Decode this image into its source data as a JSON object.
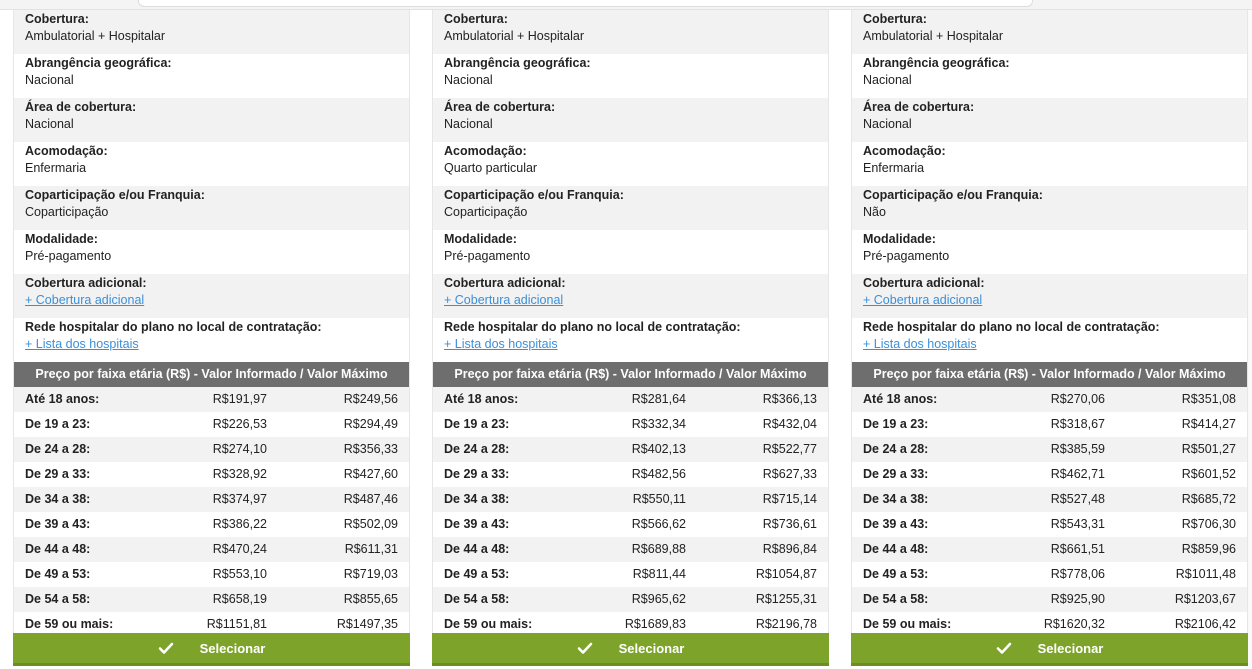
{
  "labels": {
    "cobertura": "Cobertura:",
    "abrangencia": "Abrangência geográfica:",
    "area": "Área de cobertura:",
    "acomodacao": "Acomodação:",
    "coparticipacao": "Coparticipação e/ou Franquia:",
    "modalidade": "Modalidade:",
    "cobertura_adicional": "Cobertura adicional:",
    "rede": "Rede hospitalar do plano no local de contratação:",
    "price_header": "Preço por faixa etária (R$) - Valor Informado / Valor Máximo",
    "select_button": "Selecionar"
  },
  "colors": {
    "accent_green": "#7ea32a",
    "header_gray": "#6e6e6e",
    "link_blue": "#3b8fd9"
  },
  "cards": [
    {
      "cobertura": "Ambulatorial + Hospitalar",
      "abrangencia": "Nacional",
      "area": "Nacional",
      "acomodacao": "Enfermaria",
      "coparticipacao": "Coparticipação",
      "modalidade": "Pré-pagamento",
      "cobertura_adicional_link": "+ Cobertura adicional",
      "rede_link": "+ Lista dos hospitais",
      "prices": [
        {
          "range": "Até 18 anos:",
          "informado": "R$191,97",
          "maximo": "R$249,56"
        },
        {
          "range": "De 19 a 23:",
          "informado": "R$226,53",
          "maximo": "R$294,49"
        },
        {
          "range": "De 24 a 28:",
          "informado": "R$274,10",
          "maximo": "R$356,33"
        },
        {
          "range": "De 29 a 33:",
          "informado": "R$328,92",
          "maximo": "R$427,60"
        },
        {
          "range": "De 34 a 38:",
          "informado": "R$374,97",
          "maximo": "R$487,46"
        },
        {
          "range": "De 39 a 43:",
          "informado": "R$386,22",
          "maximo": "R$502,09"
        },
        {
          "range": "De 44 a 48:",
          "informado": "R$470,24",
          "maximo": "R$611,31"
        },
        {
          "range": "De 49 a 53:",
          "informado": "R$553,10",
          "maximo": "R$719,03"
        },
        {
          "range": "De 54 a 58:",
          "informado": "R$658,19",
          "maximo": "R$855,65"
        },
        {
          "range": "De 59 ou mais:",
          "informado": "R$1151,81",
          "maximo": "R$1497,35"
        }
      ]
    },
    {
      "cobertura": "Ambulatorial + Hospitalar",
      "abrangencia": "Nacional",
      "area": "Nacional",
      "acomodacao": "Quarto particular",
      "coparticipacao": "Coparticipação",
      "modalidade": "Pré-pagamento",
      "cobertura_adicional_link": "+ Cobertura adicional",
      "rede_link": "+ Lista dos hospitais",
      "prices": [
        {
          "range": "Até 18 anos:",
          "informado": "R$281,64",
          "maximo": "R$366,13"
        },
        {
          "range": "De 19 a 23:",
          "informado": "R$332,34",
          "maximo": "R$432,04"
        },
        {
          "range": "De 24 a 28:",
          "informado": "R$402,13",
          "maximo": "R$522,77"
        },
        {
          "range": "De 29 a 33:",
          "informado": "R$482,56",
          "maximo": "R$627,33"
        },
        {
          "range": "De 34 a 38:",
          "informado": "R$550,11",
          "maximo": "R$715,14"
        },
        {
          "range": "De 39 a 43:",
          "informado": "R$566,62",
          "maximo": "R$736,61"
        },
        {
          "range": "De 44 a 48:",
          "informado": "R$689,88",
          "maximo": "R$896,84"
        },
        {
          "range": "De 49 a 53:",
          "informado": "R$811,44",
          "maximo": "R$1054,87"
        },
        {
          "range": "De 54 a 58:",
          "informado": "R$965,62",
          "maximo": "R$1255,31"
        },
        {
          "range": "De 59 ou mais:",
          "informado": "R$1689,83",
          "maximo": "R$2196,78"
        }
      ]
    },
    {
      "cobertura": "Ambulatorial + Hospitalar",
      "abrangencia": "Nacional",
      "area": "Nacional",
      "acomodacao": "Enfermaria",
      "coparticipacao": "Não",
      "modalidade": "Pré-pagamento",
      "cobertura_adicional_link": "+ Cobertura adicional",
      "rede_link": "+ Lista dos hospitais",
      "prices": [
        {
          "range": "Até 18 anos:",
          "informado": "R$270,06",
          "maximo": "R$351,08"
        },
        {
          "range": "De 19 a 23:",
          "informado": "R$318,67",
          "maximo": "R$414,27"
        },
        {
          "range": "De 24 a 28:",
          "informado": "R$385,59",
          "maximo": "R$501,27"
        },
        {
          "range": "De 29 a 33:",
          "informado": "R$462,71",
          "maximo": "R$601,52"
        },
        {
          "range": "De 34 a 38:",
          "informado": "R$527,48",
          "maximo": "R$685,72"
        },
        {
          "range": "De 39 a 43:",
          "informado": "R$543,31",
          "maximo": "R$706,30"
        },
        {
          "range": "De 44 a 48:",
          "informado": "R$661,51",
          "maximo": "R$859,96"
        },
        {
          "range": "De 49 a 53:",
          "informado": "R$778,06",
          "maximo": "R$1011,48"
        },
        {
          "range": "De 54 a 58:",
          "informado": "R$925,90",
          "maximo": "R$1203,67"
        },
        {
          "range": "De 59 ou mais:",
          "informado": "R$1620,32",
          "maximo": "R$2106,42"
        }
      ]
    }
  ]
}
